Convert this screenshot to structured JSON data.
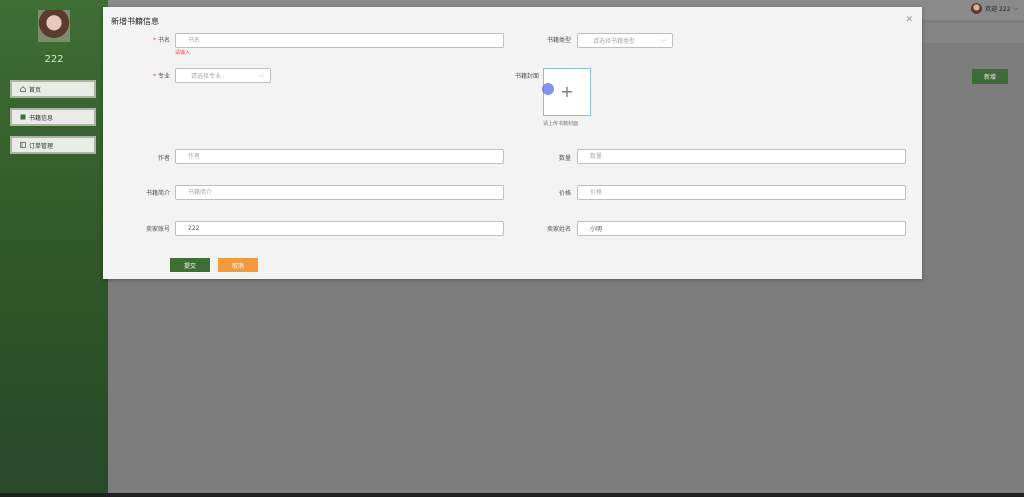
{
  "sidebar": {
    "username": "222",
    "items": [
      {
        "label": "首页",
        "icon": "home-icon"
      },
      {
        "label": "书籍信息",
        "icon": "book-icon"
      },
      {
        "label": "订单管理",
        "icon": "order-icon"
      }
    ]
  },
  "header": {
    "welcome": "欢迎 222"
  },
  "main": {
    "add_label": "新增"
  },
  "dialog": {
    "title": "新增书籍信息",
    "fields": {
      "book_name": {
        "label": "书名",
        "placeholder": "书名",
        "error": "请输入"
      },
      "category": {
        "label": "书籍类型",
        "placeholder": "请选择书籍类型"
      },
      "major": {
        "label": "专业",
        "placeholder": "请选择专业"
      },
      "cover": {
        "label": "书籍封面",
        "hint": "请上传书籍封面"
      },
      "author": {
        "label": "作者",
        "placeholder": "作者"
      },
      "quantity": {
        "label": "数量",
        "placeholder": "数量"
      },
      "intro": {
        "label": "书籍简介",
        "placeholder": "书籍简介"
      },
      "price": {
        "label": "价格",
        "placeholder": "价格"
      },
      "seller_account": {
        "label": "卖家账号",
        "value": "222"
      },
      "seller_name": {
        "label": "卖家姓名",
        "value": "小明"
      }
    },
    "submit_label": "提交",
    "cancel_label": "取消"
  },
  "colors": {
    "primary": "#3f6e35",
    "cancel": "#f39b3c",
    "error": "#e34a4a"
  }
}
